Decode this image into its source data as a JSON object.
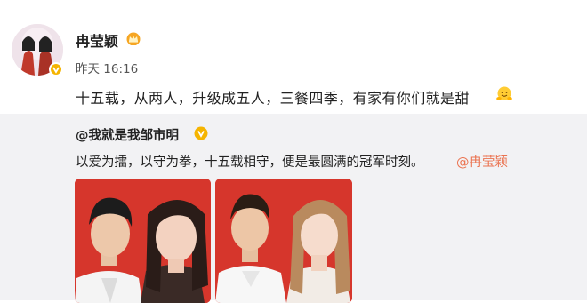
{
  "post": {
    "username": "冉莹颖",
    "time": "昨天 16:16",
    "content": "十五载，从两人，升级成五人，三餐四季，有家有你们就是甜",
    "avatar_icon": "avatar",
    "crown_icon": "crown-icon",
    "verified_icon": "verified-icon",
    "emoji_icon": "hug-emoji-icon"
  },
  "repost": {
    "username": "@我就是我邹市明",
    "text": "以爱为擂，以守为拳，十五载相守，便是最圆满的冠军时刻。",
    "mention": "@冉莹颖"
  },
  "colors": {
    "mention": "#eb7350",
    "repost_bg": "#f2f2f4",
    "photo_bg": "#d6362c",
    "verified": "#f5b400"
  }
}
